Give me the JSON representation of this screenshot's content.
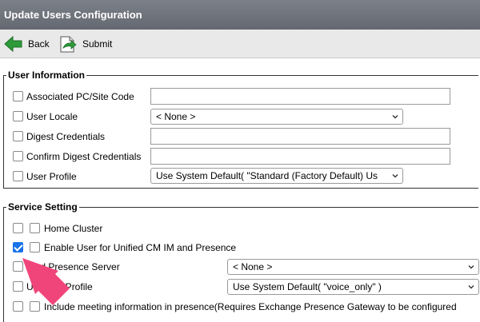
{
  "window": {
    "title": "Update Users Configuration"
  },
  "toolbar": {
    "back_label": "Back",
    "submit_label": "Submit"
  },
  "user_information": {
    "legend": "User Information",
    "associated_pc_site_code": {
      "label": "Associated PC/Site Code",
      "value": ""
    },
    "user_locale": {
      "label": "User Locale",
      "selected": "< None >"
    },
    "digest_credentials": {
      "label": "Digest Credentials",
      "value": ""
    },
    "confirm_digest_credentials": {
      "label": "Confirm Digest Credentials",
      "value": ""
    },
    "user_profile": {
      "label": "User Profile",
      "selected": "Use System Default( \"Standard (Factory Default) Us"
    }
  },
  "service_setting": {
    "legend": "Service Setting",
    "home_cluster": {
      "label": "Home Cluster"
    },
    "enable_im_presence": {
      "label": "Enable User for Unified CM IM and Presence",
      "checked": true
    },
    "assigned_presence_server": {
      "label": "Assigned Presence Server",
      "visible_label": "A      ed Presence Server",
      "selected": "< None >"
    },
    "uc_service_profile": {
      "label": "UC Service Profile",
      "visible_label": "UC Se    e Profile",
      "selected": "Use System Default( \"voice_only\" )"
    },
    "include_meeting_info": {
      "label": "Include meeting information in presence(Requires Exchange Presence Gateway to be configured"
    }
  },
  "colors": {
    "titlebar": "#6e7279",
    "toolbar": "#e9e9e9",
    "check_accent": "#1a73e8",
    "annotation_arrow": "#f0457a"
  }
}
